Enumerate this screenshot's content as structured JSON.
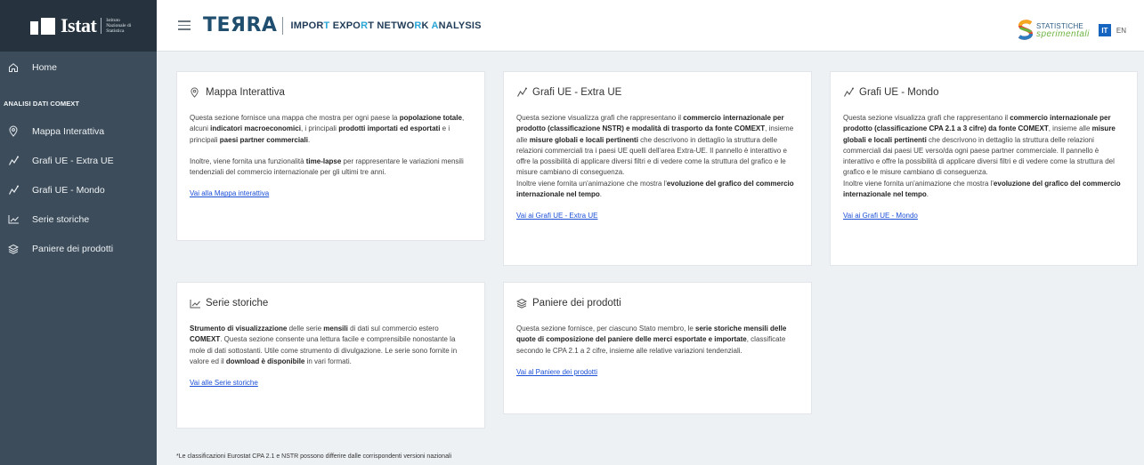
{
  "brand": {
    "name": "Istat",
    "subtitle": "Istituto Nazionale di Statistica"
  },
  "header": {
    "logo": "TEЯRA",
    "tagline_parts": [
      "IMPOR",
      "T",
      " EXPO",
      "R",
      "T NETWO",
      "R",
      "K ",
      "A",
      "NALYSIS"
    ],
    "partner_logo": {
      "line1": "STATISTICHE",
      "line2": "sperimentali"
    },
    "lang_active": "IT",
    "lang_other": "EN"
  },
  "sidebar": {
    "home": "Home",
    "section_title": "ANALISI DATI COMEXT",
    "items": [
      {
        "label": "Mappa Interattiva",
        "icon": "map-pin-icon"
      },
      {
        "label": "Grafi UE - Extra UE",
        "icon": "graph-icon"
      },
      {
        "label": "Grafi UE - Mondo",
        "icon": "graph-icon"
      },
      {
        "label": "Serie storiche",
        "icon": "line-chart-icon"
      },
      {
        "label": "Paniere dei prodotti",
        "icon": "layers-icon"
      }
    ]
  },
  "cards": {
    "mappa": {
      "title": "Mappa Interattiva",
      "link": "Vai alla Mappa interattiva"
    },
    "extra_ue": {
      "title": "Grafi UE - Extra UE",
      "link": "Vai ai Grafi UE - Extra UE"
    },
    "mondo": {
      "title": "Grafi UE - Mondo",
      "link": "Vai ai Grafi UE - Mondo"
    },
    "serie": {
      "title": "Serie storiche",
      "link": "Vai alle Serie storiche"
    },
    "paniere": {
      "title": "Paniere dei prodotti",
      "link": "Vai al Paniere dei prodotti"
    }
  },
  "card_text": {
    "mappa_p1": [
      {
        "t": "Questa sezione fornisce una mappa che mostra per ogni paese la "
      },
      {
        "t": "popolazione totale",
        "b": true
      },
      {
        "t": ", alcuni "
      },
      {
        "t": "indicatori macroeconomici",
        "b": true
      },
      {
        "t": ", i principali "
      },
      {
        "t": "prodotti importati ed esportati",
        "b": true
      },
      {
        "t": " e i principali "
      },
      {
        "t": "paesi partner commerciali",
        "b": true
      },
      {
        "t": "."
      }
    ],
    "mappa_p2": [
      {
        "t": "Inoltre, viene fornita una funzionalità "
      },
      {
        "t": "time-lapse",
        "b": true
      },
      {
        "t": " per rappresentare le variazioni mensili tendenziali del commercio internazionale per gli ultimi tre anni."
      }
    ],
    "extra_p1": [
      {
        "t": "Questa sezione visualizza grafi che rappresentano il "
      },
      {
        "t": "commercio internazionale per prodotto (classificazione NSTR) e modalità di trasporto da fonte COMEXT",
        "b": true
      },
      {
        "t": ", insieme alle "
      },
      {
        "t": "misure globali e locali pertinenti",
        "b": true
      },
      {
        "t": " che descrivono in dettaglio la struttura delle relazioni commerciali tra i paesi UE quelli dell'area Extra-UE. Il pannello è interattivo e offre la possibilità di applicare diversi filtri e di vedere come la struttura del grafico e le misure cambiano di conseguenza."
      },
      {
        "br": true
      },
      {
        "t": "Inoltre viene fornita un'animazione che mostra l'"
      },
      {
        "t": "evoluzione del grafico del commercio internazionale nel tempo",
        "b": true
      },
      {
        "t": "."
      }
    ],
    "mondo_p1": [
      {
        "t": "Questa sezione visualizza grafi che rappresentano il "
      },
      {
        "t": "commercio internazionale per prodotto (classificazione CPA 2.1 a 3 cifre) da fonte COMEXT",
        "b": true
      },
      {
        "t": ", insieme alle "
      },
      {
        "t": "misure globali e locali pertinenti",
        "b": true
      },
      {
        "t": " che descrivono in dettaglio la struttura delle relazioni commerciali dai paesi UE verso/da ogni paese partner commerciale. Il pannello è interattivo e offre la possibilità di applicare diversi filtri e di vedere come la struttura del grafico e le misure cambiano di conseguenza."
      },
      {
        "br": true
      },
      {
        "t": "Inoltre viene fornita un'animazione che mostra l'"
      },
      {
        "t": "evoluzione del grafico del commercio internazionale nel tempo",
        "b": true
      },
      {
        "t": "."
      }
    ],
    "serie_p1": [
      {
        "t": "Strumento di visualizzazione",
        "b": true
      },
      {
        "t": " delle serie "
      },
      {
        "t": "mensili",
        "b": true
      },
      {
        "t": " di dati sul commercio estero "
      },
      {
        "t": "COMEXT",
        "b": true
      },
      {
        "t": ". Questa sezione consente una lettura facile e comprensibile nonostante la mole di dati sottostanti. Utile come strumento di divulgazione. Le serie sono fornite in valore ed il "
      },
      {
        "t": "download è disponibile",
        "b": true
      },
      {
        "t": " in vari formati."
      }
    ],
    "paniere_p1": [
      {
        "t": "Questa sezione fornisce, per ciascuno Stato membro, le "
      },
      {
        "t": "serie storiche mensili delle quote di composizione del paniere delle merci esportate e importate",
        "b": true
      },
      {
        "t": ", classificate secondo le CPA 2.1 a 2 cifre, insieme alle relative variazioni tendenziali."
      }
    ]
  },
  "footnote": "*Le classificazioni Eurostat CPA 2.1 e NSTR possono differire dalle corrispondenti versioni nazionali",
  "colors": {
    "sidebar": "#3c4c5a",
    "brand_bar": "#26333e",
    "accent": "#1565c0",
    "link": "#1a4fd6",
    "tagline_highlight": "#29a5d6"
  }
}
